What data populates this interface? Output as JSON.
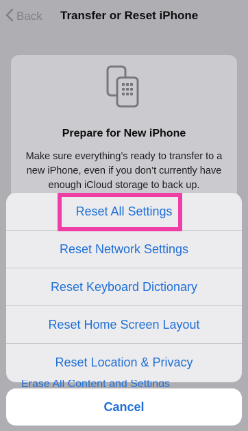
{
  "nav": {
    "back_label": "Back",
    "title": "Transfer or Reset iPhone"
  },
  "card": {
    "icon": "two-phones-icon",
    "title": "Prepare for New iPhone",
    "description": "Make sure everything’s ready to transfer to a new iPhone, even if you don’t currently have enough iCloud storage to back up."
  },
  "sheet": {
    "items": [
      {
        "label": "Reset All Settings"
      },
      {
        "label": "Reset Network Settings"
      },
      {
        "label": "Reset Keyboard Dictionary"
      },
      {
        "label": "Reset Home Screen Layout"
      },
      {
        "label": "Reset Location & Privacy"
      }
    ],
    "cancel_label": "Cancel"
  },
  "background": {
    "partial_item": "Erase All Content and Settings"
  },
  "colors": {
    "accent": "#1f6fd6",
    "highlight": "#f03ea7"
  }
}
